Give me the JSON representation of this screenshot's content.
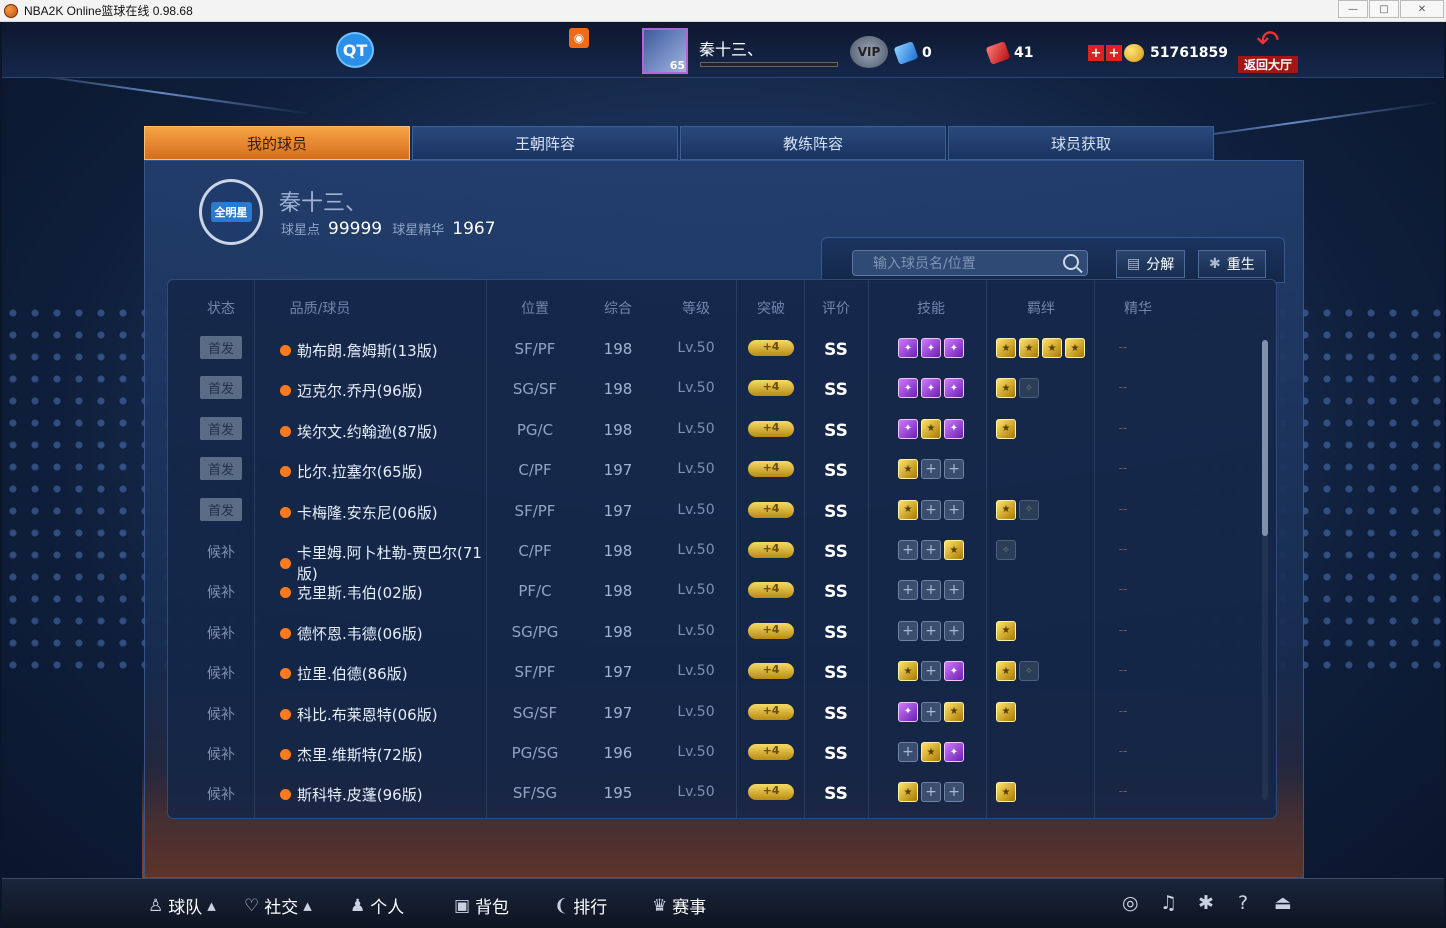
{
  "window": {
    "title": "NBA2K Online篮球在线 0.98.68",
    "controls": [
      "—",
      "□",
      "✕"
    ]
  },
  "topbar": {
    "qt_label": "QT",
    "player_name": "秦十三、",
    "player_level": "65",
    "vip_label": "VIP",
    "blue_gems": "0",
    "red_gems": "41",
    "coins": "51761859",
    "back_label": "返回大厅"
  },
  "tabs": [
    {
      "label": "我的球员",
      "active": true
    },
    {
      "label": "王朝阵容",
      "active": false
    },
    {
      "label": "教练阵容",
      "active": false
    },
    {
      "label": "球员获取",
      "active": false
    }
  ],
  "owner": {
    "badge_label": "全明星",
    "name": "秦十三、",
    "star_points_label": "球星点",
    "star_points": "99999",
    "essence_label": "球星精华",
    "essence": "1967"
  },
  "toolbar": {
    "search_placeholder": "输入球员名/位置",
    "decompose_label": "分解",
    "rebirth_label": "重生"
  },
  "table": {
    "headers": [
      "状态",
      "品质/球员",
      "位置",
      "综合",
      "等级",
      "突破",
      "评价",
      "技能",
      "羁绊",
      "精华"
    ],
    "rows": [
      {
        "status": "首发",
        "name": "勒布朗.詹姆斯(13版)",
        "pos": "SF/PF",
        "ovr": "198",
        "lv": "Lv.50",
        "brk": "+4",
        "grade": "SS",
        "skills": [
          "skill",
          "skill",
          "skill"
        ],
        "bonds": [
          "gold",
          "gold",
          "gold",
          "gold"
        ],
        "ess": "--"
      },
      {
        "status": "首发",
        "name": "迈克尔.乔丹(96版)",
        "pos": "SG/SF",
        "ovr": "198",
        "lv": "Lv.50",
        "brk": "+4",
        "grade": "SS",
        "skills": [
          "skill",
          "skill",
          "skill"
        ],
        "bonds": [
          "gold",
          "dim"
        ],
        "ess": "--"
      },
      {
        "status": "首发",
        "name": "埃尔文.约翰逊(87版)",
        "pos": "PG/C",
        "ovr": "198",
        "lv": "Lv.50",
        "brk": "+4",
        "grade": "SS",
        "skills": [
          "skill",
          "gold",
          "skill"
        ],
        "bonds": [
          "gold"
        ],
        "ess": "--"
      },
      {
        "status": "首发",
        "name": "比尔.拉塞尔(65版)",
        "pos": "C/PF",
        "ovr": "197",
        "lv": "Lv.50",
        "brk": "+4",
        "grade": "SS",
        "skills": [
          "gold",
          "empty",
          "empty"
        ],
        "bonds": [],
        "ess": "--"
      },
      {
        "status": "首发",
        "name": "卡梅隆.安东尼(06版)",
        "pos": "SF/PF",
        "ovr": "197",
        "lv": "Lv.50",
        "brk": "+4",
        "grade": "SS",
        "skills": [
          "gold",
          "empty",
          "empty"
        ],
        "bonds": [
          "gold",
          "dim"
        ],
        "ess": "--"
      },
      {
        "status": "候补",
        "name": "卡里姆.阿卜杜勒-贾巴尔(71版)",
        "pos": "C/PF",
        "ovr": "198",
        "lv": "Lv.50",
        "brk": "+4",
        "grade": "SS",
        "skills": [
          "empty",
          "empty",
          "gold"
        ],
        "bonds": [
          "dim"
        ],
        "ess": "--"
      },
      {
        "status": "候补",
        "name": "克里斯.韦伯(02版)",
        "pos": "PF/C",
        "ovr": "198",
        "lv": "Lv.50",
        "brk": "+4",
        "grade": "SS",
        "skills": [
          "empty",
          "empty",
          "empty"
        ],
        "bonds": [],
        "ess": "--"
      },
      {
        "status": "候补",
        "name": "德怀恩.韦德(06版)",
        "pos": "SG/PG",
        "ovr": "198",
        "lv": "Lv.50",
        "brk": "+4",
        "grade": "SS",
        "skills": [
          "empty",
          "empty",
          "empty"
        ],
        "bonds": [
          "gold"
        ],
        "ess": "--"
      },
      {
        "status": "候补",
        "name": "拉里.伯德(86版)",
        "pos": "SF/PF",
        "ovr": "197",
        "lv": "Lv.50",
        "brk": "+4",
        "grade": "SS",
        "skills": [
          "gold",
          "empty",
          "skill"
        ],
        "bonds": [
          "gold",
          "dim"
        ],
        "ess": "--"
      },
      {
        "status": "候补",
        "name": "科比.布莱恩特(06版)",
        "pos": "SG/SF",
        "ovr": "197",
        "lv": "Lv.50",
        "brk": "+4",
        "grade": "SS",
        "skills": [
          "skill",
          "empty",
          "gold"
        ],
        "bonds": [
          "gold"
        ],
        "ess": "--"
      },
      {
        "status": "候补",
        "name": "杰里.维斯特(72版)",
        "pos": "PG/SG",
        "ovr": "196",
        "lv": "Lv.50",
        "brk": "+4",
        "grade": "SS",
        "skills": [
          "empty",
          "gold",
          "skill"
        ],
        "bonds": [],
        "ess": "--"
      },
      {
        "status": "候补",
        "name": "斯科特.皮蓬(96版)",
        "pos": "SF/SG",
        "ovr": "195",
        "lv": "Lv.50",
        "brk": "+4",
        "grade": "SS",
        "skills": [
          "gold",
          "empty",
          "empty"
        ],
        "bonds": [
          "gold"
        ],
        "ess": "--"
      }
    ]
  },
  "bottom_nav": [
    {
      "label": "球队",
      "icon": "team-icon"
    },
    {
      "label": "社交",
      "icon": "social-icon"
    },
    {
      "label": "个人",
      "icon": "person-icon"
    },
    {
      "label": "背包",
      "icon": "backpack-icon"
    },
    {
      "label": "排行",
      "icon": "ranking-icon"
    },
    {
      "label": "赛事",
      "icon": "trophy-icon"
    }
  ],
  "right_icons": [
    "headset-icon",
    "music-icon",
    "settings-icon",
    "help-icon",
    "exit-icon"
  ]
}
